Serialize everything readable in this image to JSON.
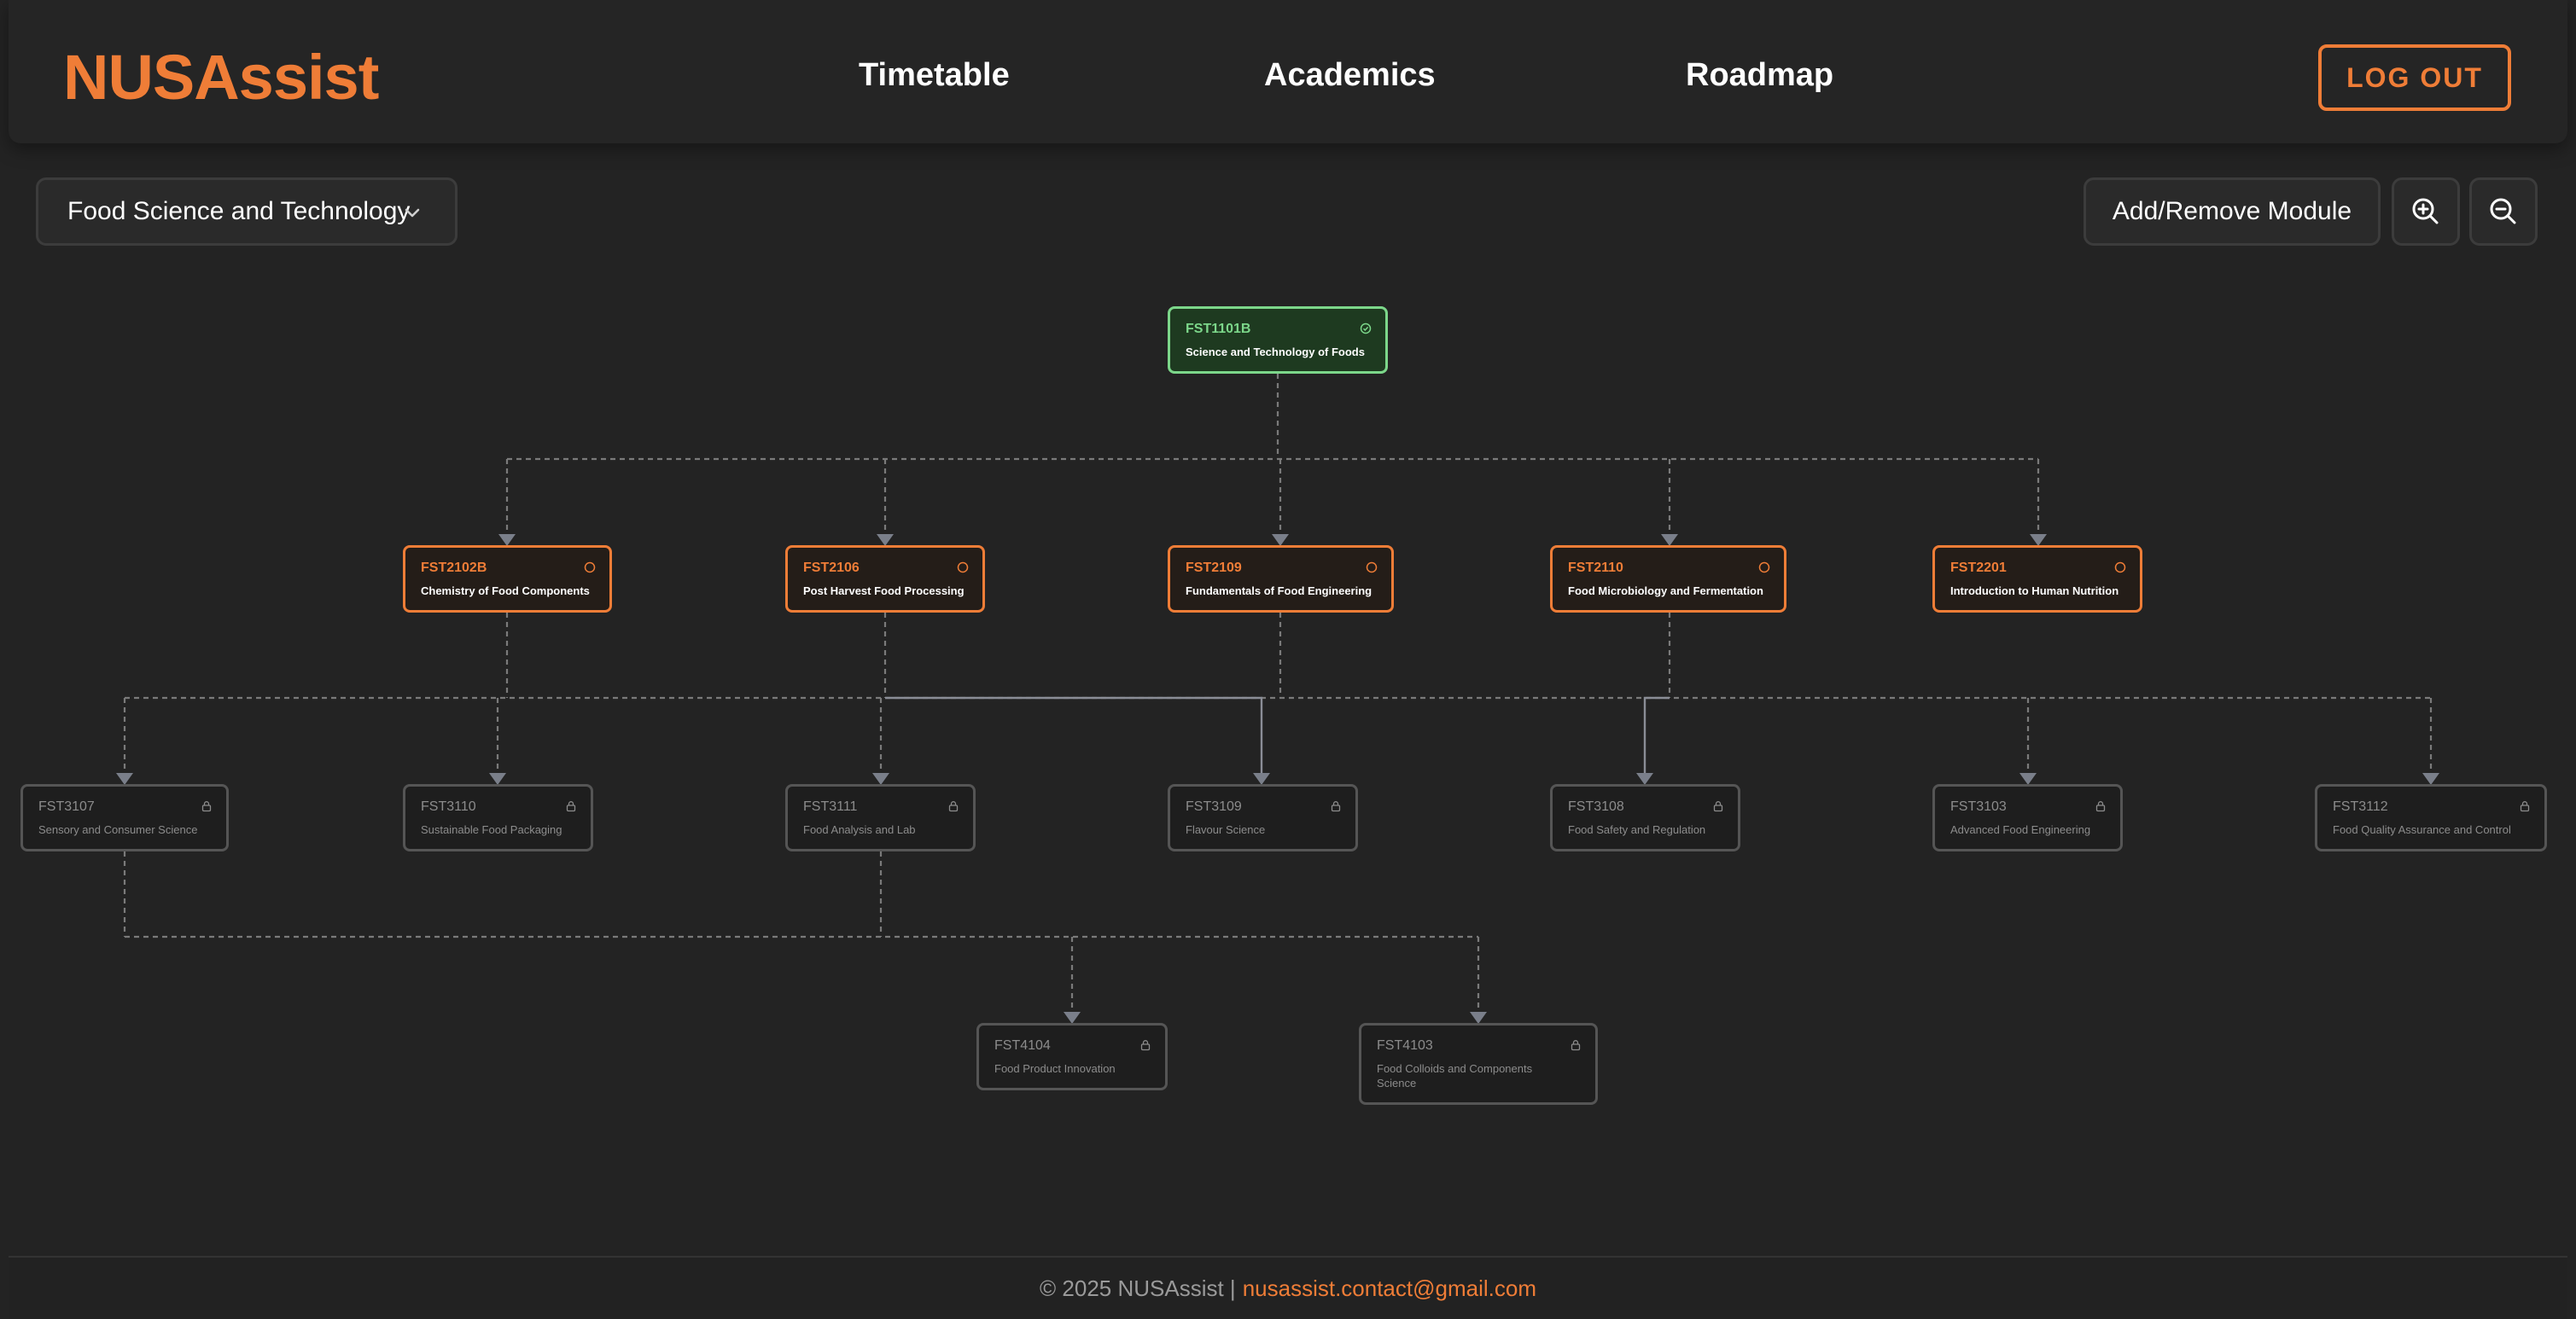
{
  "app": {
    "name": "NUSAssist"
  },
  "nav": {
    "timetable": "Timetable",
    "academics": "Academics",
    "roadmap": "Roadmap"
  },
  "header": {
    "logout_label": "LOG OUT"
  },
  "toolbar": {
    "major_selected": "Food Science and Technology",
    "add_remove_label": "Add/Remove Module",
    "zoom_in_icon": "zoom-in-icon",
    "zoom_out_icon": "zoom-out-icon"
  },
  "colors": {
    "accent": "#ef7d37",
    "completed": "#7cd78a",
    "locked": "#8c8c8c",
    "background": "#232323"
  },
  "modules": {
    "fst1101b": {
      "code": "FST1101B",
      "name": "Science and Technology of Foods",
      "status": "completed"
    },
    "fst2102b": {
      "code": "FST2102B",
      "name": "Chemistry of Food Components",
      "status": "available"
    },
    "fst2106": {
      "code": "FST2106",
      "name": "Post Harvest Food Processing",
      "status": "available"
    },
    "fst2109": {
      "code": "FST2109",
      "name": "Fundamentals of Food Engineering",
      "status": "available"
    },
    "fst2110": {
      "code": "FST2110",
      "name": "Food Microbiology and Fermentation",
      "status": "available"
    },
    "fst2201": {
      "code": "FST2201",
      "name": "Introduction to Human Nutrition",
      "status": "available"
    },
    "fst3107": {
      "code": "FST3107",
      "name": "Sensory and Consumer Science",
      "status": "locked"
    },
    "fst3110": {
      "code": "FST3110",
      "name": "Sustainable Food Packaging",
      "status": "locked"
    },
    "fst3111": {
      "code": "FST3111",
      "name": "Food Analysis and Lab",
      "status": "locked"
    },
    "fst3109": {
      "code": "FST3109",
      "name": "Flavour Science",
      "status": "locked"
    },
    "fst3108": {
      "code": "FST3108",
      "name": "Food Safety and Regulation",
      "status": "locked"
    },
    "fst3103": {
      "code": "FST3103",
      "name": "Advanced Food Engineering",
      "status": "locked"
    },
    "fst3112": {
      "code": "FST3112",
      "name": "Food Quality Assurance and Control",
      "status": "locked"
    },
    "fst4104": {
      "code": "FST4104",
      "name": "Food Product Innovation",
      "status": "locked"
    },
    "fst4103": {
      "code": "FST4103",
      "name": "Food Colloids and Components Science",
      "status": "locked"
    }
  },
  "footer": {
    "copyright": "© 2025 NUSAssist |",
    "email": "nusassist.contact@gmail.com"
  }
}
